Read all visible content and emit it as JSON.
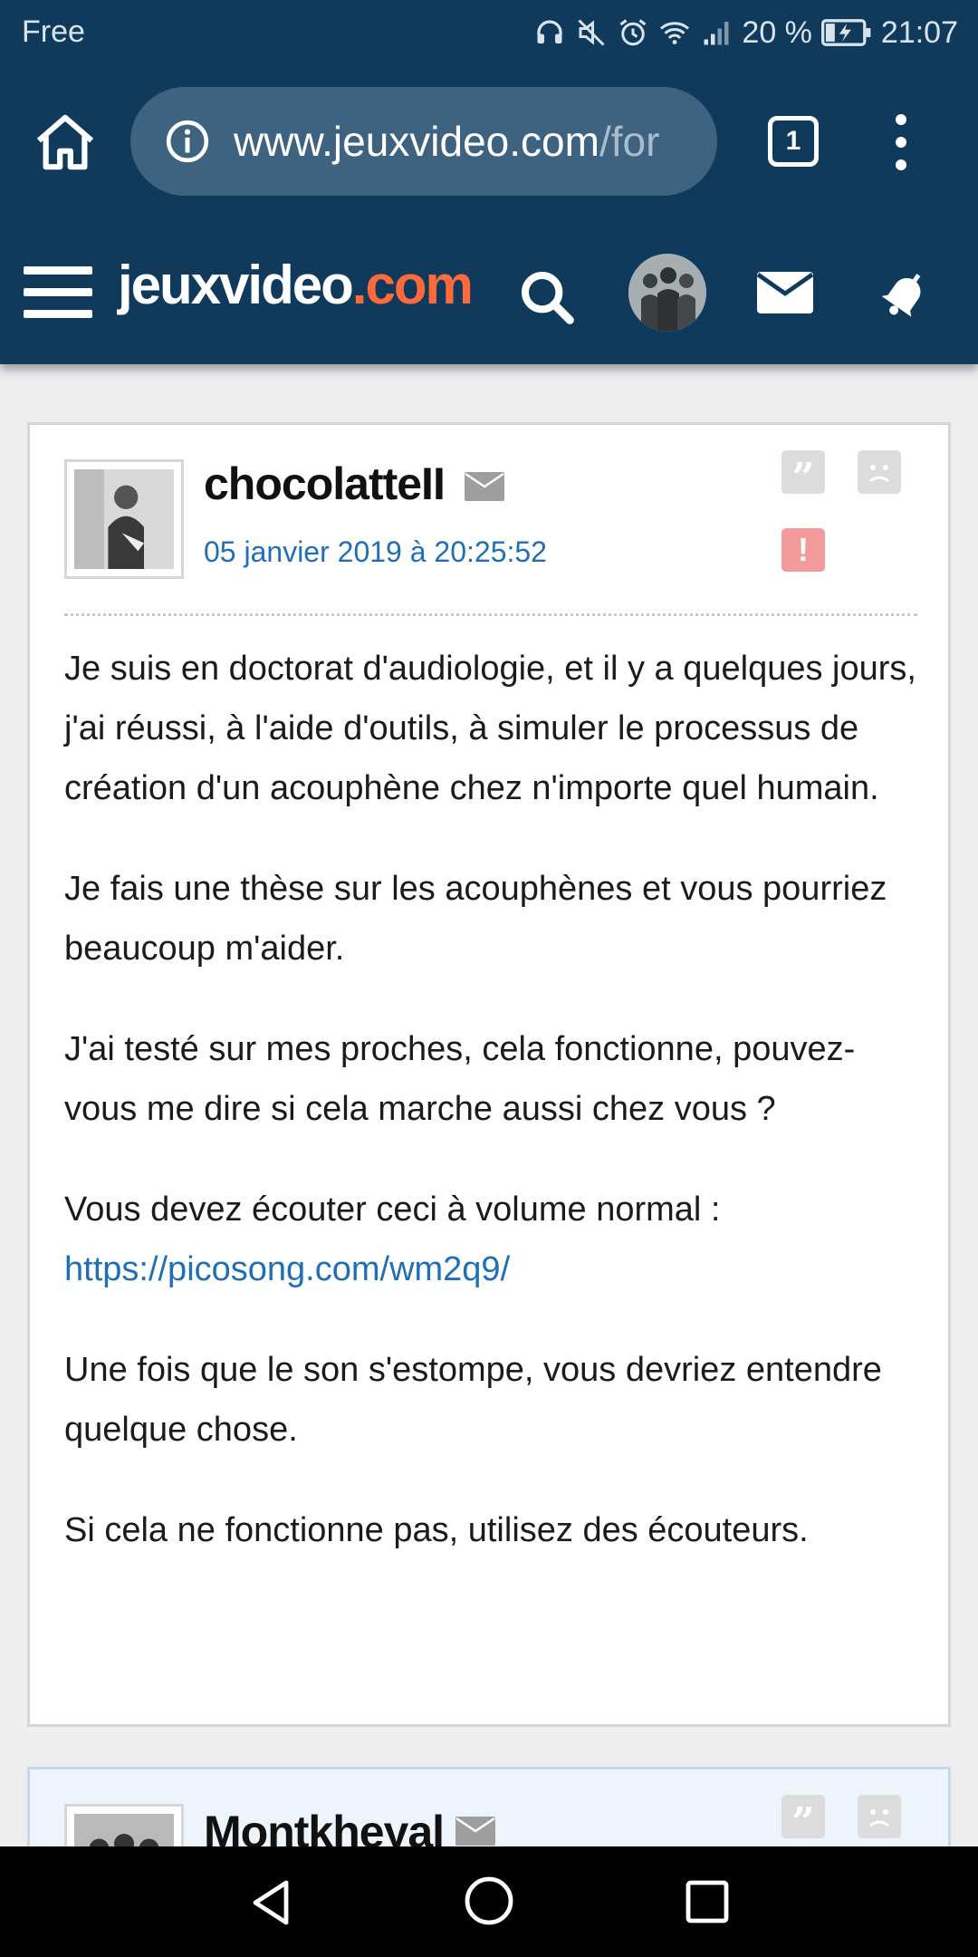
{
  "status_bar": {
    "carrier": "Free",
    "battery": "20 %",
    "time": "21:07",
    "icons": [
      "headphones-icon",
      "mute-icon",
      "alarm-icon",
      "wifi-icon",
      "signal-icon",
      "battery-charging-icon"
    ]
  },
  "browser": {
    "url_main": "www.jeuxvideo.com",
    "url_rest": "/for",
    "tab_count": "1"
  },
  "site": {
    "logo_main": "jeuxvideo",
    "logo_accent": ".com",
    "accent_color": "#ff6a3d",
    "header_color": "#0f3a5c"
  },
  "posts": [
    {
      "author": "chocolatteII",
      "date": "05 janvier 2019 à 20:25:52",
      "quote_glyph": "”",
      "alert_glyph": "!",
      "paragraphs": [
        "Je suis en doctorat d'audiologie, et il y a quelques jours, j'ai réussi, à l'aide d'outils, à simuler le processus de création d'un acouphène chez n'importe quel humain.",
        "Je fais une thèse sur les acouphènes et vous pourriez beaucoup m'aider.",
        "J'ai testé sur mes proches, cela fonctionne, pouvez-vous me dire si cela marche aussi chez vous ?",
        "Vous devez écouter ceci à volume normal :",
        "Une fois que le son s'estompe, vous devriez entendre quelque chose.",
        "Si cela ne fonctionne pas, utilisez des écouteurs."
      ],
      "link": "https://picosong.com/wm2q9/"
    },
    {
      "author": "Montkheyal",
      "quote_glyph": "”"
    }
  ]
}
